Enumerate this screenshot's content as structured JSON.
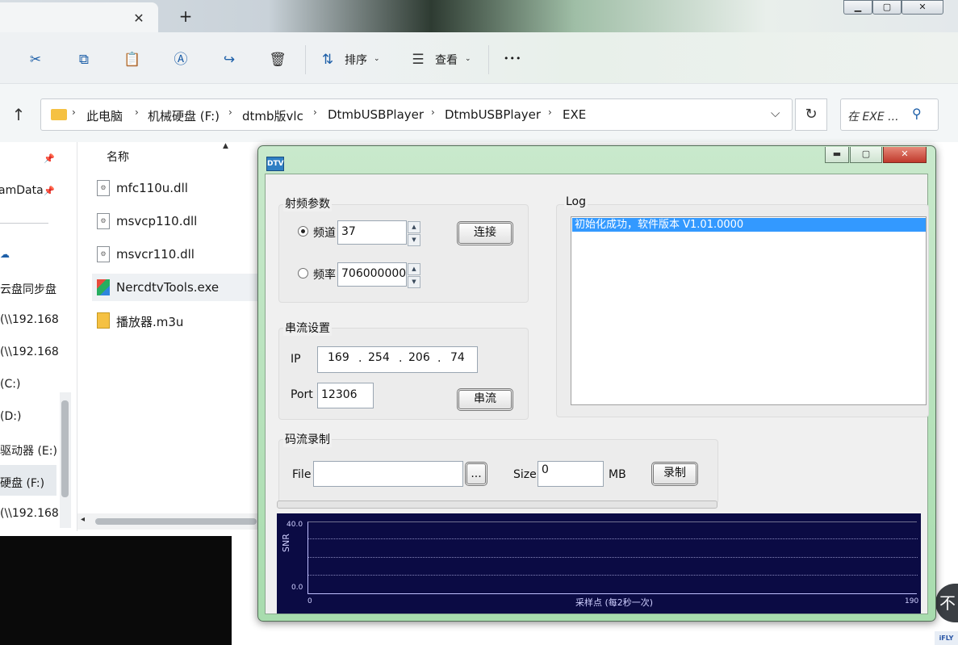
{
  "explorer": {
    "tab_close": "✕",
    "tab_new": "+",
    "window_controls": [
      "▁",
      "▢",
      "✕"
    ],
    "toolbar": {
      "sort_label": "排序",
      "view_label": "查看",
      "more": "•••"
    },
    "breadcrumb": [
      "此电脑",
      "机械硬盘 (F:)",
      "dtmb版vlc",
      "DtmbUSBPlayer",
      "DtmbUSBPlayer",
      "EXE"
    ],
    "search_placeholder": "在 EXE ...",
    "nav_items": [
      "amData",
      "云盘同步盘",
      "(\\\\192.168",
      "(\\\\192.168",
      "(C:)",
      "(D:)",
      "驱动器 (E:)",
      "硬盘 (F:)",
      "(\\\\192.168"
    ],
    "column_name": "名称",
    "files": [
      {
        "name": "mfc110u.dll",
        "icon": "dll-file-icon"
      },
      {
        "name": "msvcp110.dll",
        "icon": "dll-file-icon"
      },
      {
        "name": "msvcr110.dll",
        "icon": "dll-file-icon"
      },
      {
        "name": "NercdtvTools.exe",
        "icon": "exe-app-icon"
      },
      {
        "name": "播放器.m3u",
        "icon": "playlist-file-icon"
      }
    ]
  },
  "dtv": {
    "logo": "DTV",
    "controls": [
      "▬",
      "▢",
      "✕"
    ],
    "rf": {
      "title": "射频参数",
      "channel_label": "频道",
      "channel_value": "37",
      "freq_label": "频率",
      "freq_value": "706000000",
      "connect": "连接"
    },
    "stream": {
      "title": "串流设置",
      "ip_label": "IP",
      "ip": [
        "169",
        "254",
        "206",
        "74"
      ],
      "port_label": "Port",
      "port_value": "12306",
      "stream_button": "串流"
    },
    "log": {
      "title": "Log",
      "line": "初始化成功，软件版本 V1.01.0000"
    },
    "record": {
      "title": "码流录制",
      "file_label": "File",
      "file_value": "",
      "browse": "...",
      "size_label": "Size",
      "size_value": "0",
      "size_unit": "MB",
      "record_button": "录制"
    },
    "chart": {
      "ylabel": "SNR",
      "y_max": "40.0",
      "y_min": "0.0",
      "x_min": "0",
      "x_max": "190",
      "xlabel": "采样点 (每2秒一次)"
    }
  },
  "right_float": "不",
  "ifly_badge": "iFLY"
}
